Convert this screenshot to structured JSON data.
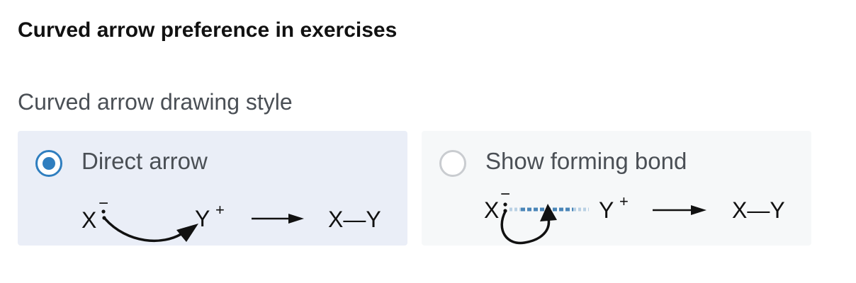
{
  "section": {
    "title": "Curved arrow preference in exercises"
  },
  "style_group": {
    "label": "Curved arrow drawing style",
    "options": [
      {
        "label": "Direct arrow",
        "selected": true,
        "scheme": {
          "left_atom": "X",
          "left_charge": "−",
          "right_atom": "Y",
          "right_charge": "+",
          "product": "X—Y"
        }
      },
      {
        "label": "Show forming bond",
        "selected": false,
        "scheme": {
          "left_atom": "X",
          "left_charge": "−",
          "right_atom": "Y",
          "right_charge": "+",
          "product": "X—Y"
        }
      }
    ]
  },
  "colors": {
    "accent": "#2f7ebf",
    "selected_card_bg": "#eaeef7",
    "unselected_card_bg": "#f6f8f9",
    "forming_bond": "#4a86b8"
  },
  "icons": {
    "radio_selected": "radio-selected-icon",
    "radio_unselected": "radio-unselected-icon",
    "curved_arrow": "curved-arrow-icon",
    "reaction_arrow": "reaction-arrow-icon",
    "forming_bond": "forming-bond-icon"
  }
}
